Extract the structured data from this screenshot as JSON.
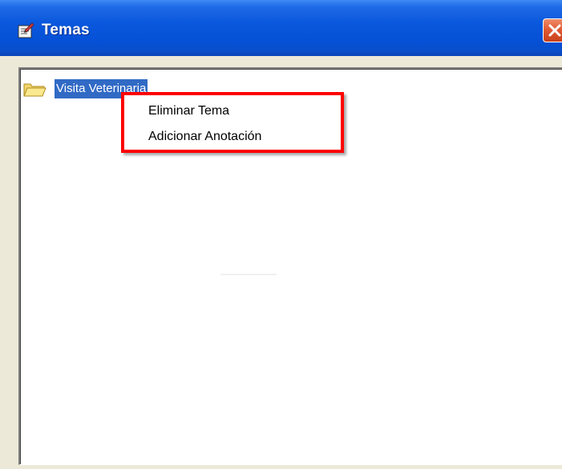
{
  "window": {
    "title": "Temas",
    "icon": "notes-app-icon",
    "close_icon": "close-icon"
  },
  "tree": {
    "nodes": [
      {
        "label": "Visita Veterinaria",
        "icon": "folder-icon",
        "selected": true
      }
    ]
  },
  "context_menu": {
    "highlight_color": "#ff0000",
    "items": [
      {
        "label": "Eliminar Tema"
      },
      {
        "label": "Adicionar Anotación"
      }
    ]
  },
  "colors": {
    "titlebar": "#0a58dd",
    "selection": "#316ac5",
    "close_button": "#e05b35"
  }
}
